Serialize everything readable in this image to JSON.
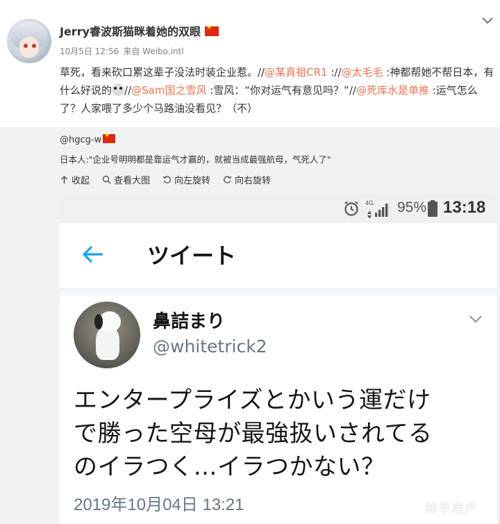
{
  "post": {
    "username": "Jerry睿波斯猫眯着她的双眼",
    "date": "10月5日 12:56",
    "source": "来自 Weibo.intl",
    "text_segments": [
      {
        "t": "草死，看来砍口累这辈子没法时装企业惹。//",
        "mention": false
      },
      {
        "t": "@某真祖CR1",
        "mention": true
      },
      {
        "t": " ://",
        "mention": false
      },
      {
        "t": "@太毛毛",
        "mention": true
      },
      {
        "t": " :神都帮她不帮日本，有什么好说的",
        "mention": false
      },
      {
        "t": "",
        "emoji": true
      },
      {
        "t": "//",
        "mention": false
      },
      {
        "t": "@Sam国之雪风",
        "mention": true
      },
      {
        "t": " :雪风：“你对运气有意见吗？”//",
        "mention": false
      },
      {
        "t": "@死库水是单推",
        "mention": true
      },
      {
        "t": " :运气怎么了？人家喂了多少个马路油没看见？（不）",
        "mention": false
      }
    ]
  },
  "repost": {
    "username": "@hgcg-w",
    "text": "日本人:\"企业号明明都是靠运气才赢的，就被当成最强航母，气死人了\"",
    "toolbar": {
      "collapse": "收起",
      "view_large": "查看大图",
      "rotate_left": "向左旋转",
      "rotate_right": "向右旋转"
    }
  },
  "phone": {
    "network": "4G",
    "battery": "95%",
    "time": "13:18"
  },
  "tweet": {
    "header_title": "ツイート",
    "name": "鼻詰まり",
    "handle": "@whitetrick2",
    "lines": [
      "エンタープライズとかいう運だけ",
      "で勝った空母が最強扱いされてる",
      "のイラつく…イラつかない？"
    ],
    "timestamp": "2019年10月04日 13:21"
  },
  "watermark": "知乎用户",
  "colors": {
    "mention": "#eb7350",
    "repost_bg": "#f2f2f5",
    "twitter_blue": "#1da1f2"
  }
}
